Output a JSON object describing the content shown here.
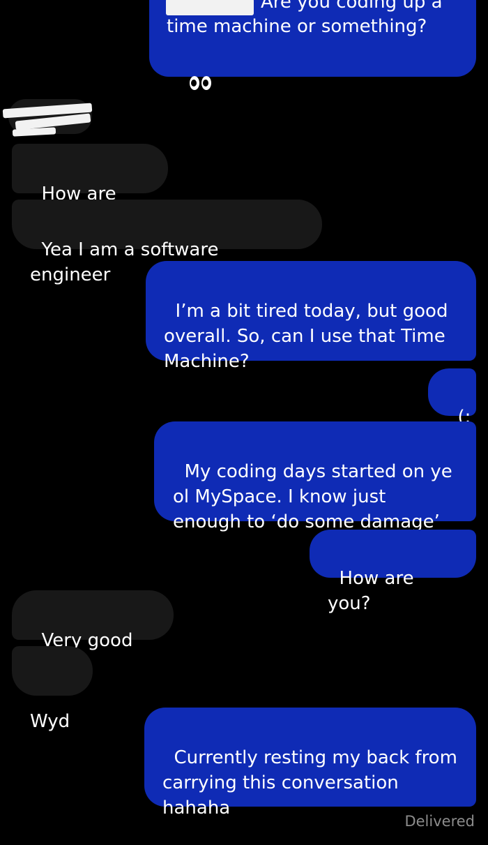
{
  "colors": {
    "background": "#000000",
    "sent_bubble": "#0f2bb5",
    "received_bubble": "#181818",
    "delivered_text": "#8c8c8c"
  },
  "messages": [
    {
      "side": "sent",
      "text": "Are you coding up a"
    },
    {
      "side": "sent",
      "text": "time machine or something?"
    },
    {
      "side": "received",
      "text": "How are you"
    },
    {
      "side": "received",
      "text": "Yea I am a software engineer"
    },
    {
      "side": "sent",
      "text": "I’m a bit tired today, but good\noverall. So, can I use that Time\nMachine?"
    },
    {
      "side": "sent",
      "text": "(:"
    },
    {
      "side": "sent",
      "text": "My coding days started on ye\nol MySpace. I know just\nenough to ‘do some damage’"
    },
    {
      "side": "sent",
      "text": "How are you?"
    },
    {
      "side": "received",
      "text": "Very good lol"
    },
    {
      "side": "received",
      "text": "Wyd"
    },
    {
      "side": "sent",
      "text": "Currently resting my back from\ncarrying this conversation\nhahaha"
    }
  ],
  "icons": {
    "eyes": "eyes-emoji-icon"
  },
  "status": {
    "delivered": "Delivered"
  }
}
